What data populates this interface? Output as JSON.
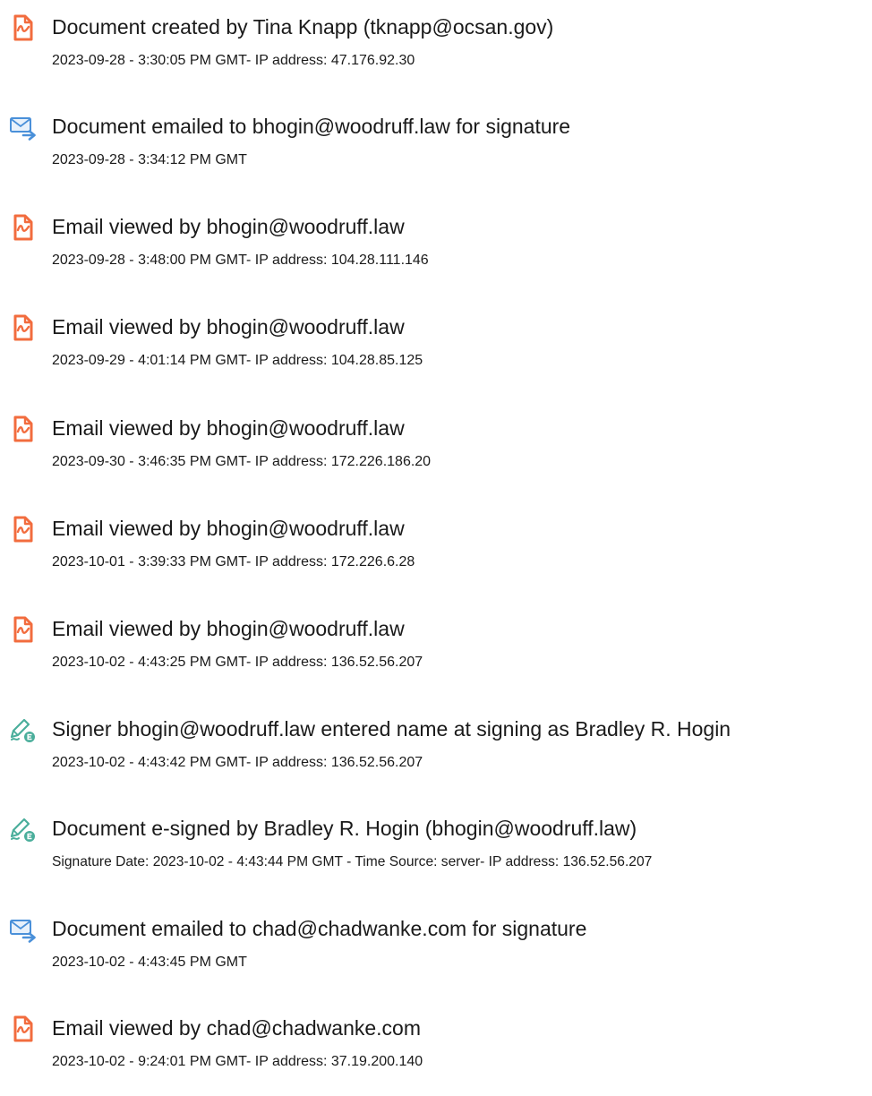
{
  "events": [
    {
      "type": "created",
      "icon": "document-icon",
      "title": "Document created by Tina Knapp (tknapp@ocsan.gov)",
      "detail": "2023-09-28 - 3:30:05 PM GMT- IP address: 47.176.92.30"
    },
    {
      "type": "emailed",
      "icon": "email-sent-icon",
      "title": "Document emailed to bhogin@woodruff.law for signature",
      "detail": "2023-09-28 - 3:34:12 PM GMT"
    },
    {
      "type": "viewed",
      "icon": "document-icon",
      "title": "Email viewed by bhogin@woodruff.law",
      "detail": "2023-09-28 - 3:48:00 PM GMT- IP address: 104.28.111.146"
    },
    {
      "type": "viewed",
      "icon": "document-icon",
      "title": "Email viewed by bhogin@woodruff.law",
      "detail": "2023-09-29 - 4:01:14 PM GMT- IP address: 104.28.85.125"
    },
    {
      "type": "viewed",
      "icon": "document-icon",
      "title": "Email viewed by bhogin@woodruff.law",
      "detail": "2023-09-30 - 3:46:35 PM GMT- IP address: 172.226.186.20"
    },
    {
      "type": "viewed",
      "icon": "document-icon",
      "title": "Email viewed by bhogin@woodruff.law",
      "detail": "2023-10-01 - 3:39:33 PM GMT- IP address: 172.226.6.28"
    },
    {
      "type": "viewed",
      "icon": "document-icon",
      "title": "Email viewed by bhogin@woodruff.law",
      "detail": "2023-10-02 - 4:43:25 PM GMT- IP address: 136.52.56.207"
    },
    {
      "type": "name-entered",
      "icon": "esign-pen-icon",
      "title": "Signer bhogin@woodruff.law entered name at signing as Bradley R. Hogin",
      "detail": "2023-10-02 - 4:43:42 PM GMT- IP address: 136.52.56.207"
    },
    {
      "type": "esigned",
      "icon": "esign-pen-icon",
      "title": "Document e-signed by Bradley R. Hogin (bhogin@woodruff.law)",
      "detail": "Signature Date: 2023-10-02 - 4:43:44 PM GMT - Time Source: server- IP address: 136.52.56.207"
    },
    {
      "type": "emailed",
      "icon": "email-sent-icon",
      "title": "Document emailed to chad@chadwanke.com for signature",
      "detail": "2023-10-02 - 4:43:45 PM GMT"
    },
    {
      "type": "viewed",
      "icon": "document-icon",
      "title": "Email viewed by chad@chadwanke.com",
      "detail": "2023-10-02 - 9:24:01 PM GMT- IP address: 37.19.200.140"
    }
  ],
  "colors": {
    "document_icon": "#f26c3e",
    "email_icon": "#4a90d9",
    "esign_icon": "#4aae9b",
    "text": "#1a1a1a"
  }
}
